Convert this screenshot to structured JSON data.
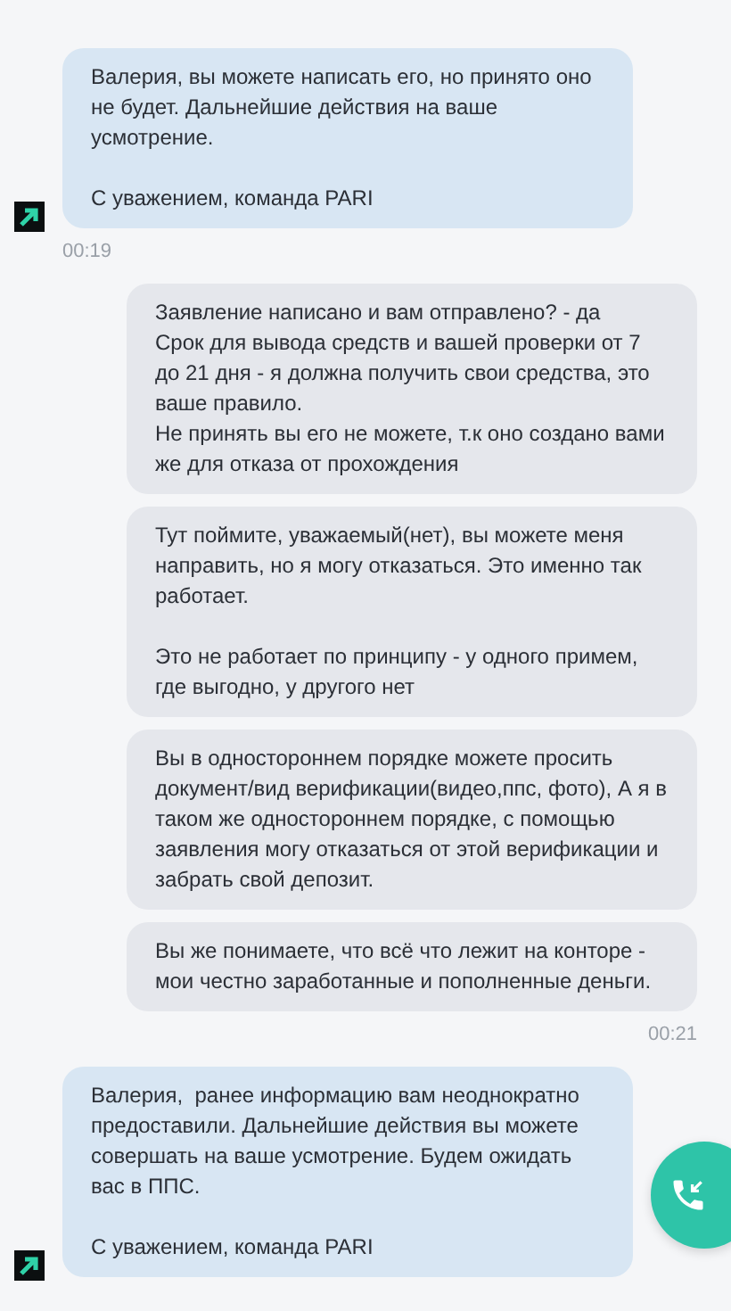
{
  "messages": [
    {
      "kind": "incoming",
      "paragraphs": [
        "Валерия, вы можете написать его, но принято оно не будет. Дальнейшие действия на ваше усмотрение.",
        "С уважением, команда PARI"
      ],
      "time": "00:19"
    },
    {
      "kind": "outgoing",
      "paragraphs": [
        "Заявление написано и вам отправлено? - да\nСрок для вывода средств и вашей проверки от 7 до 21 дня - я должна получить свои средства, это ваше правило.\nНе принять вы его не можете, т.к оно создано вами же для отказа от прохождения"
      ]
    },
    {
      "kind": "outgoing",
      "paragraphs": [
        "Тут поймите, уважаемый(нет), вы можете меня направить, но я могу отказаться. Это именно так работает.",
        "Это не работает по принципу - у одного примем, где выгодно, у другого нет"
      ]
    },
    {
      "kind": "outgoing",
      "paragraphs": [
        "Вы в одностороннем порядке можете просить документ/вид верификации(видео,ппс, фото), А я в таком же одностороннем порядке, с помощью заявления могу отказаться от этой верификации и забрать свой депозит."
      ]
    },
    {
      "kind": "outgoing",
      "paragraphs": [
        "Вы же понимаете, что всё что лежит на конторе - мои честно заработанные и пополненные деньги."
      ],
      "time": "00:21"
    },
    {
      "kind": "incoming",
      "paragraphs": [
        "Валерия,  ранее информацию вам неоднократно предоставили. Дальнейшие действия вы можете совершать на ваше усмотрение. Будем ожидать вас в ППС.",
        "С уважением, команда PARI"
      ]
    }
  ]
}
